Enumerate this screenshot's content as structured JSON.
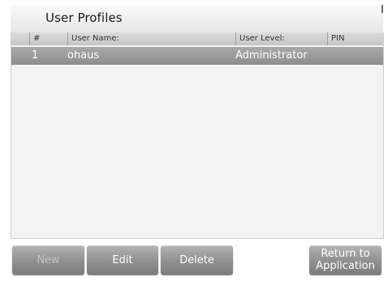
{
  "header": {
    "title": "User Profiles"
  },
  "table": {
    "columns": [
      "#",
      "User Name:",
      "User Level:",
      "PIN"
    ],
    "rows": [
      {
        "num": "1",
        "name": "ohaus",
        "level": "Administrator",
        "pin": ""
      }
    ]
  },
  "buttons": {
    "new": "New",
    "edit": "Edit",
    "delete": "Delete",
    "return_line1": "Return to",
    "return_line2": "Application"
  },
  "colors": {
    "selected_row": "#9a9a9a",
    "button": "#929292"
  }
}
